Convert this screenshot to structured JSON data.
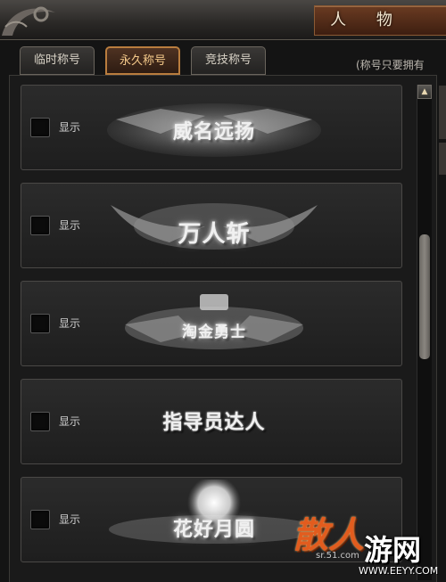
{
  "window": {
    "title": "人 物"
  },
  "tabs": [
    {
      "label": "临时称号",
      "active": false
    },
    {
      "label": "永久称号",
      "active": true
    },
    {
      "label": "竞技称号",
      "active": false
    }
  ],
  "hint": "(称号只要拥有",
  "rows": [
    {
      "checkbox_label": "显示",
      "checked": false,
      "title_name": "威名远扬"
    },
    {
      "checkbox_label": "显示",
      "checked": false,
      "title_name": "万人斩"
    },
    {
      "checkbox_label": "显示",
      "checked": false,
      "title_name": "淘金勇士"
    },
    {
      "checkbox_label": "显示",
      "checked": false,
      "title_name": "指导员达人"
    },
    {
      "checkbox_label": "显示",
      "checked": false,
      "title_name": "花好月圆"
    }
  ],
  "watermark": {
    "logo_text": "散人",
    "brand": "游网",
    "small_text": "sr.51.com",
    "url": "WWW.EEYY.COM"
  },
  "colors": {
    "active_tab_border": "#b97d3e",
    "active_tab_text": "#f4c98a",
    "title_plate": "#5a301b"
  }
}
